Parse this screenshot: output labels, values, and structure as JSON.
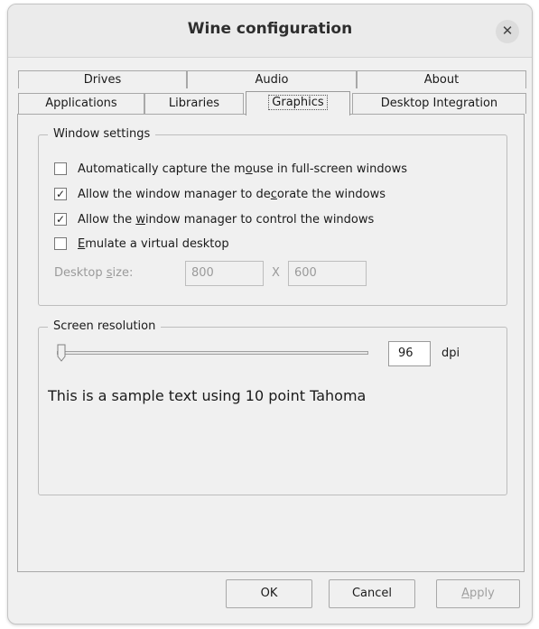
{
  "window": {
    "title": "Wine configuration"
  },
  "tabs": {
    "row_top": [
      "Drives",
      "Audio",
      "About"
    ],
    "row_bottom": [
      "Applications",
      "Libraries",
      "Graphics",
      "Desktop Integration"
    ],
    "active": "Graphics"
  },
  "window_settings": {
    "legend": "Window settings",
    "options": [
      {
        "pre": "Automatically capture the m",
        "accel": "o",
        "post": "use in full-screen windows",
        "checked": false
      },
      {
        "pre": "Allow the window manager to de",
        "accel": "c",
        "post": "orate the windows",
        "checked": true
      },
      {
        "pre": "Allow the ",
        "accel": "w",
        "post": "indow manager to control the windows",
        "checked": true
      },
      {
        "pre": "",
        "accel": "E",
        "post": "mulate a virtual desktop",
        "checked": false
      }
    ],
    "desktop_size": {
      "label_pre": "Desktop ",
      "label_accel": "s",
      "label_post": "ize:",
      "width": "800",
      "separator": "X",
      "height": "600"
    }
  },
  "screen_resolution": {
    "legend": "Screen resolution",
    "dpi_value": "96",
    "dpi_unit": "dpi",
    "slider_fraction": 0.0,
    "sample_text": "This is a sample text using 10 point Tahoma"
  },
  "buttons": {
    "ok": "OK",
    "cancel": "Cancel",
    "apply_accel": "A",
    "apply_post": "pply"
  },
  "icons": {
    "close": "close-icon",
    "check": "checkmark-icon"
  }
}
